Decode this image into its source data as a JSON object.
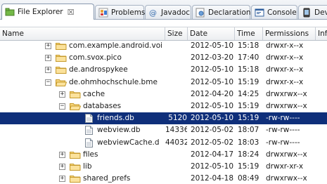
{
  "tabs": [
    {
      "label": "File Explorer",
      "close": "☒",
      "active": true
    },
    {
      "label": "Problems"
    },
    {
      "label": "Javadoc"
    },
    {
      "label": "Declaration"
    },
    {
      "label": "Console"
    },
    {
      "label": "Dev"
    }
  ],
  "columns": [
    "Name",
    "Size",
    "Date",
    "Time",
    "Permissions",
    "Inf"
  ],
  "rows": [
    {
      "name": "com.example.android.voi",
      "size": "",
      "date": "2012-05-10",
      "time": "15:18",
      "perm": "drwxr-x--x",
      "expander": "+",
      "type": "folder",
      "depth": 0
    },
    {
      "name": "com.svox.pico",
      "size": "",
      "date": "2012-03-20",
      "time": "17:40",
      "perm": "drwxr-x--x",
      "expander": "+",
      "type": "folder",
      "depth": 0
    },
    {
      "name": "de.androspykee",
      "size": "",
      "date": "2012-05-10",
      "time": "15:18",
      "perm": "drwxr-x--x",
      "expander": "+",
      "type": "folder",
      "depth": 0
    },
    {
      "name": "de.ohmhochschule.bme",
      "size": "",
      "date": "2012-05-10",
      "time": "15:19",
      "perm": "drwxr-x--x",
      "expander": "−",
      "type": "folder",
      "depth": 0
    },
    {
      "name": "cache",
      "size": "",
      "date": "2012-04-20",
      "time": "14:25",
      "perm": "drwxrwx--x",
      "expander": "+",
      "type": "folder",
      "depth": 1
    },
    {
      "name": "databases",
      "size": "",
      "date": "2012-05-10",
      "time": "15:19",
      "perm": "drwxrwx--x",
      "expander": "−",
      "type": "folder",
      "depth": 1
    },
    {
      "name": "friends.db",
      "size": "5120",
      "date": "2012-05-10",
      "time": "15:19",
      "perm": "-rw-rw----",
      "expander": "",
      "type": "file",
      "depth": 2,
      "selected": true
    },
    {
      "name": "webview.db",
      "size": "14336",
      "date": "2012-05-02",
      "time": "18:07",
      "perm": "-rw-rw----",
      "expander": "",
      "type": "file",
      "depth": 2
    },
    {
      "name": "webviewCache.d",
      "size": "44032",
      "date": "2012-05-02",
      "time": "18:03",
      "perm": "-rw-rw----",
      "expander": "",
      "type": "file",
      "depth": 2
    },
    {
      "name": "files",
      "size": "",
      "date": "2012-04-17",
      "time": "18:24",
      "perm": "drwxrwx--x",
      "expander": "+",
      "type": "folder",
      "depth": 1
    },
    {
      "name": "lib",
      "size": "",
      "date": "2012-05-10",
      "time": "15:19",
      "perm": "drwxr-xr-x",
      "expander": "+",
      "type": "folder",
      "depth": 1
    },
    {
      "name": "shared_prefs",
      "size": "",
      "date": "2012-04-18",
      "time": "08:49",
      "perm": "drwxrwx--x",
      "expander": "+",
      "type": "folder",
      "depth": 1
    }
  ]
}
